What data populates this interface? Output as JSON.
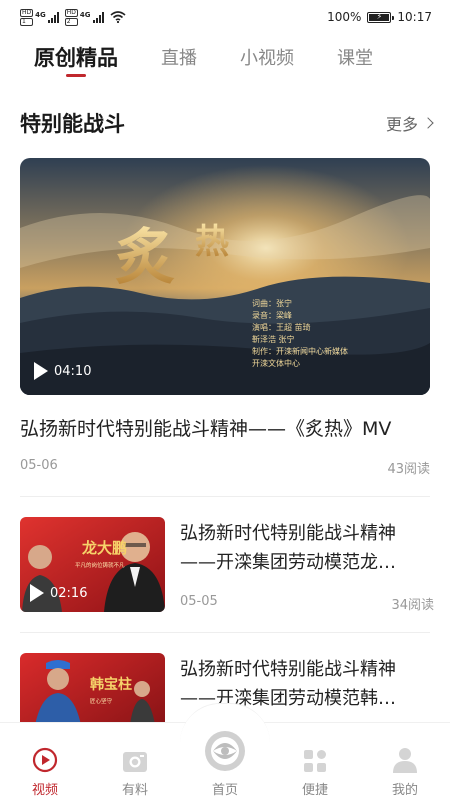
{
  "status_bar": {
    "sim1_hd": "HD",
    "sim1_slot": "1",
    "sim2_hd": "HD",
    "sim2_slot": "2",
    "network1": "4G",
    "network2": "4G",
    "battery": "100%",
    "time": "10:17"
  },
  "top_tabs": [
    {
      "label": "原创精品",
      "active": true
    },
    {
      "label": "直播",
      "active": false
    },
    {
      "label": "小视频",
      "active": false
    },
    {
      "label": "课堂",
      "active": false
    }
  ],
  "section": {
    "title": "特别能战斗",
    "more": "更多"
  },
  "featured": {
    "title": "弘扬新时代特别能战斗精神——《炙热》MV",
    "duration": "04:10",
    "date": "05-06",
    "reads": "43阅读",
    "overlay": {
      "calligraphy_1": "炙",
      "calligraphy_2": "热",
      "credits": [
        "词曲：张宁",
        "录音：梁峰",
        "演唱：王超  苗琦",
        "      靳泽浩  张宁",
        "制作：开滦新闻中心新媒体",
        "      开滦文体中心"
      ]
    }
  },
  "list": [
    {
      "title_line1": "弘扬新时代特别能战斗精神",
      "title_line2": "——开滦集团劳动模范龙…",
      "duration": "02:16",
      "date": "05-05",
      "reads": "34阅读",
      "thumb_name": "龙大鹏",
      "thumb_caption": "平凡的岗位铸就不凡"
    },
    {
      "title_line1": "弘扬新时代特别能战斗精神",
      "title_line2": "——开滦集团劳动模范韩…",
      "thumb_name": "韩宝柱",
      "thumb_caption": "匠心坚守"
    }
  ],
  "bottom_nav": [
    {
      "label": "视频",
      "icon": "video-play-icon",
      "active": true
    },
    {
      "label": "有料",
      "icon": "camera-icon",
      "active": false
    },
    {
      "label": "首页",
      "icon": "home-logo-icon",
      "active": false
    },
    {
      "label": "便捷",
      "icon": "grid-apps-icon",
      "active": false
    },
    {
      "label": "我的",
      "icon": "profile-icon",
      "active": false
    }
  ],
  "colors": {
    "accent": "#c0272d",
    "text_primary": "#222222",
    "text_muted": "#999999"
  }
}
